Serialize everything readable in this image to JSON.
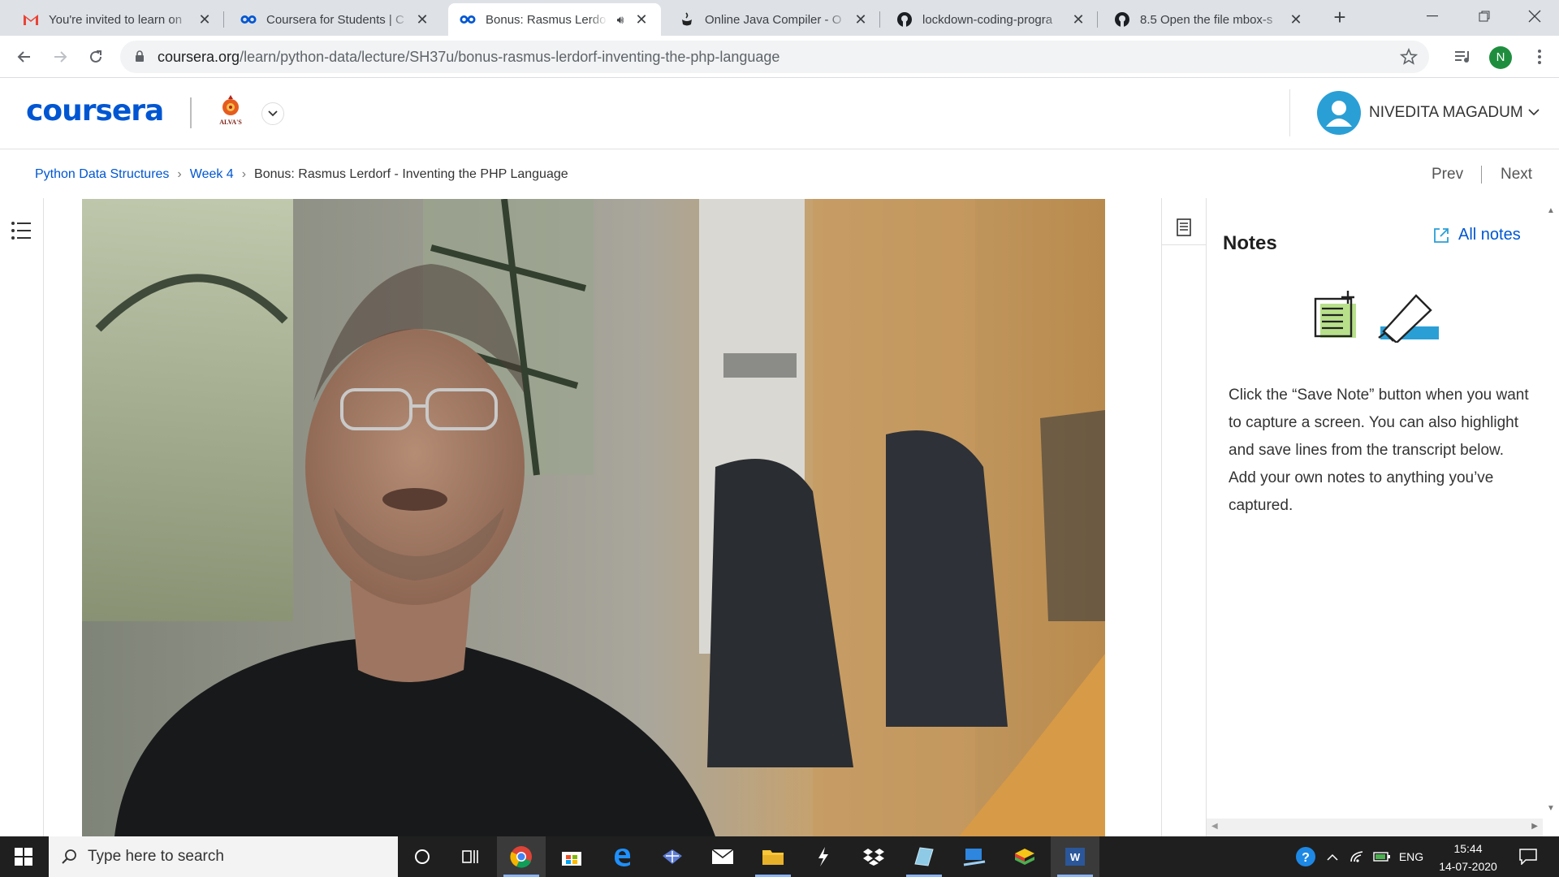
{
  "browser": {
    "tabs": [
      {
        "title": "You're invited to learn on",
        "icon": "gmail-icon"
      },
      {
        "title": "Coursera for Students | C",
        "icon": "coursera-icon"
      },
      {
        "title": "Bonus: Rasmus Lerdo",
        "icon": "coursera-icon",
        "active": true,
        "audio": true
      },
      {
        "title": "Online Java Compiler - O",
        "icon": "java-icon"
      },
      {
        "title": "lockdown-coding-progra",
        "icon": "github-icon"
      },
      {
        "title": "8.5 Open the file mbox-s",
        "icon": "github-icon"
      }
    ],
    "url_domain": "coursera.org",
    "url_path": "/learn/python-data/lecture/SH37u/bonus-rasmus-lerdorf-inventing-the-php-language",
    "profile_initial": "N"
  },
  "header": {
    "logo": "coursera",
    "org_name": "ALVA'S",
    "user_name": "NIVEDITA MAGADUM"
  },
  "breadcrumb": {
    "course": "Python Data Structures",
    "week": "Week 4",
    "current": "Bonus: Rasmus Lerdorf - Inventing the PHP Language"
  },
  "nav": {
    "prev": "Prev",
    "next": "Next"
  },
  "notes": {
    "title": "Notes",
    "all_notes": "All notes",
    "help_text": "Click the “Save Note” button when you want to capture a screen. You can also highlight and save lines from the transcript below. Add your own notes to anything you’ve captured."
  },
  "taskbar": {
    "search_placeholder": "Type here to search",
    "language": "ENG",
    "time": "15:44",
    "date": "14-07-2020"
  },
  "colors": {
    "coursera_blue": "#0056d2",
    "user_avatar": "#2a9fd6",
    "highlighter_blue": "#2a9fd6",
    "note_green": "#b8e08a"
  }
}
